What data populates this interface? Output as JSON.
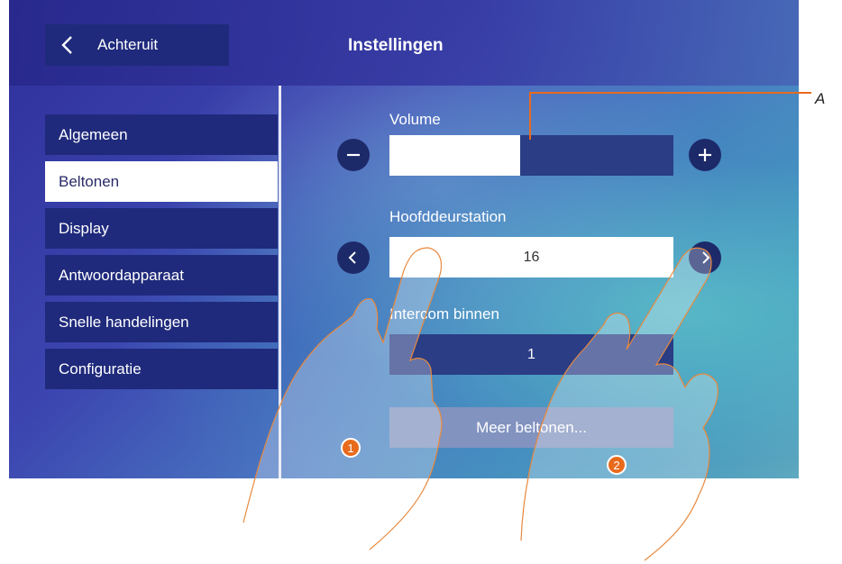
{
  "header": {
    "back_label": "Achteruit",
    "title": "Instellingen"
  },
  "menu": [
    {
      "label": "Algemeen",
      "active": false
    },
    {
      "label": "Beltonen",
      "active": true
    },
    {
      "label": "Display",
      "active": false
    },
    {
      "label": "Antwoordapparaat",
      "active": false
    },
    {
      "label": "Snelle handelingen",
      "active": false
    },
    {
      "label": "Configuratie",
      "active": false
    }
  ],
  "volume": {
    "label": "Volume",
    "level_fraction": 0.46
  },
  "main_door": {
    "label": "Hoofddeurstation",
    "value": "16"
  },
  "intercom": {
    "label": "Intercom binnen",
    "value": "1"
  },
  "more_button": "Meer beltonen...",
  "annotations": {
    "callout": "A",
    "step1": "1",
    "step2": "2"
  },
  "colors": {
    "accent": "#e86a1c",
    "panel": "#1f2a7c"
  }
}
